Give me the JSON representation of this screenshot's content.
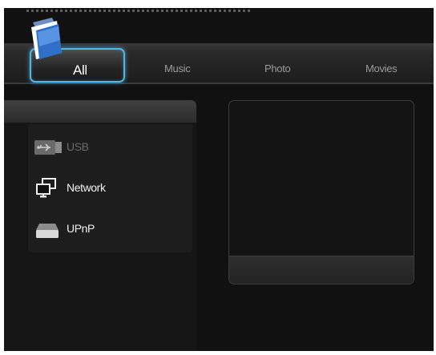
{
  "tabs": {
    "all": "All",
    "music": "Music",
    "photo": "Photo",
    "movies": "Movies"
  },
  "sources": {
    "usb": "USB",
    "network": "Network",
    "upnp": "UPnP"
  },
  "icons": {
    "folder": "folder-icon",
    "usb": "usb-icon",
    "network": "network-icon",
    "upnp": "upnp-icon"
  },
  "colors": {
    "accent": "#4fb8e8",
    "background": "#111111",
    "disabled_text": "#6a6a6a"
  }
}
